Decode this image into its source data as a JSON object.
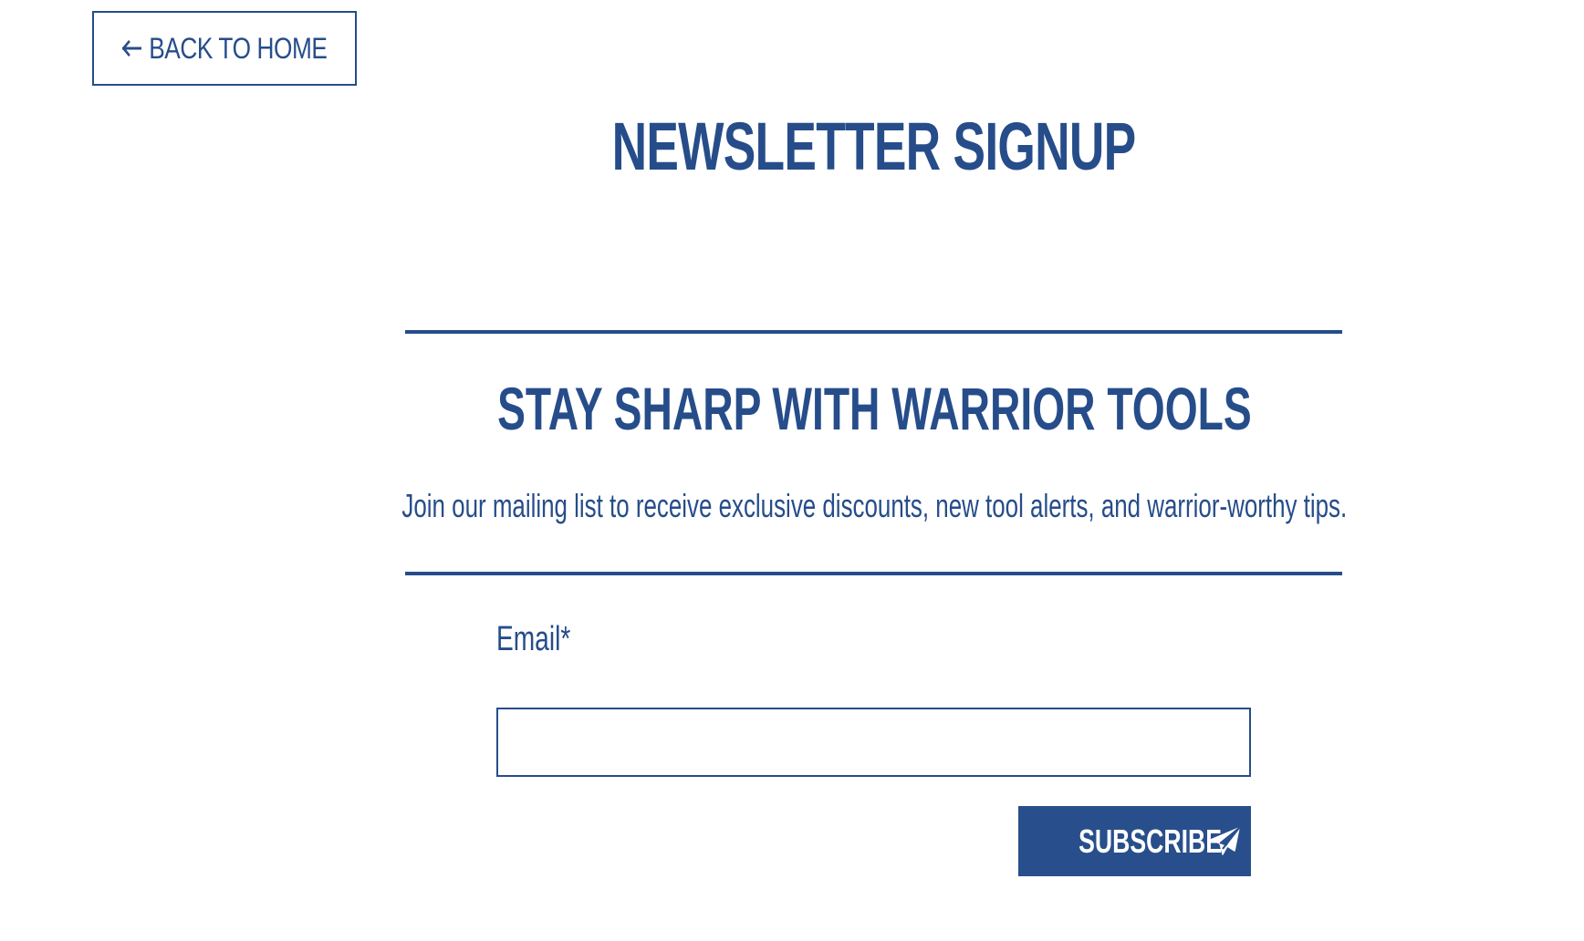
{
  "nav": {
    "back_label": "BACK TO HOME",
    "back_icon": "arrow-left-icon"
  },
  "page": {
    "title": "NEWSLETTER SIGNUP"
  },
  "section": {
    "heading": "STAY SHARP WITH WARRIOR TOOLS",
    "intro": "Join our mailing list to receive exclusive discounts, new tool alerts, and warrior-worthy tips."
  },
  "form": {
    "email_label": "Email*",
    "email_value": "",
    "email_placeholder": "",
    "submit_label": "SUBSCRIBE",
    "submit_icon": "paper-plane-icon"
  },
  "colors": {
    "primary": "#264d8a",
    "button_bg": "#284f8c",
    "background": "#ffffff"
  }
}
